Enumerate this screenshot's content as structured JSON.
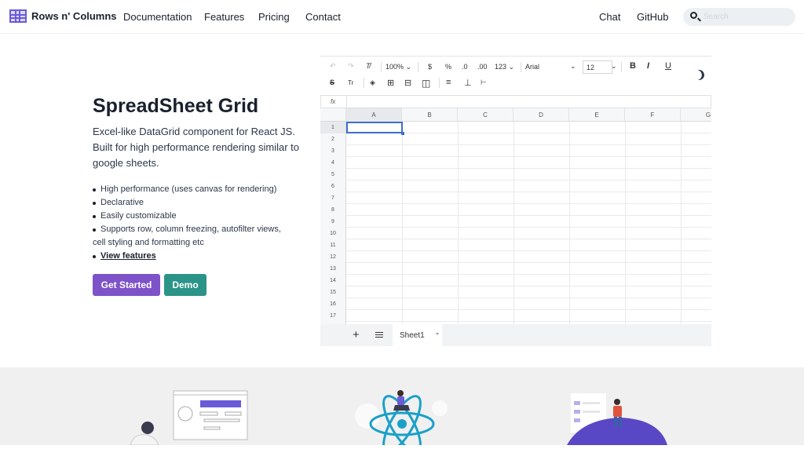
{
  "nav": {
    "brand": "Rows n' Columns",
    "links": [
      "Documentation",
      "Features",
      "Pricing",
      "Contact"
    ],
    "right_links": [
      "Chat",
      "GitHub"
    ],
    "search_placeholder": "Search"
  },
  "hero": {
    "title": "SpreadSheet Grid",
    "description": "Excel-like DataGrid component for React JS. Built for high performance rendering similar to google sheets.",
    "features": [
      "High performance (uses canvas for rendering)",
      "Declarative",
      "Easily customizable",
      "Supports row, column freezing, autofilter views,"
    ],
    "features_continuation": "cell styling and formatting etc",
    "view_features": "View features",
    "get_started": "Get Started",
    "demo": "Demo"
  },
  "spreadsheet": {
    "zoom": "100%",
    "currency": "$",
    "percent": "%",
    "decrease_decimal": ".0",
    "increase_decimal": ".00",
    "number_format": "123",
    "font": "Arial",
    "font_size": "12",
    "bold": "B",
    "italic": "I",
    "underline": "U",
    "fx": "fx",
    "columns": [
      "A",
      "B",
      "C",
      "D",
      "E",
      "F",
      "G"
    ],
    "rows": [
      "1",
      "2",
      "3",
      "4",
      "5",
      "6",
      "7",
      "8",
      "9",
      "10",
      "11",
      "12",
      "13",
      "14",
      "15",
      "16",
      "17"
    ],
    "sheet_tab": "Sheet1",
    "add_sheet": "+"
  },
  "colors": {
    "primary": "#7e52c8",
    "demo": "#2b9488",
    "selection": "#3b6fc9"
  }
}
